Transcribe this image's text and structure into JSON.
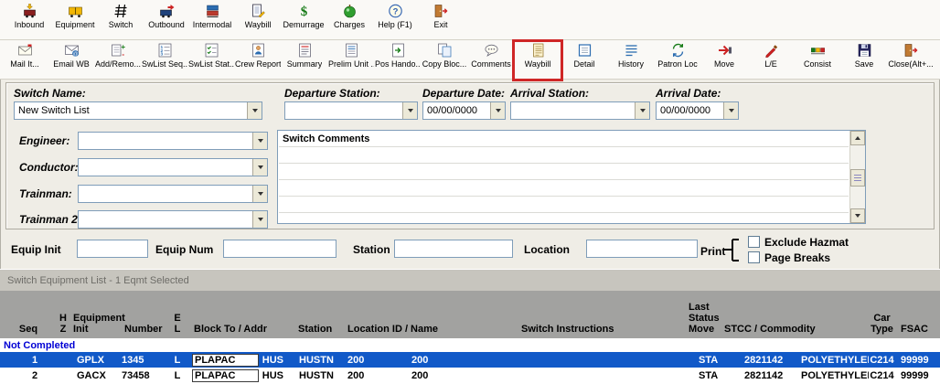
{
  "colors": {
    "highlight_box_red": "#CF2626",
    "selected_row_blue": "#1159C8",
    "group_label_blue": "#0000D4",
    "grid_header_gray": "#A2A2A0"
  },
  "toolbar_main": {
    "items": [
      {
        "label": "Inbound",
        "icon": "inbound-icon"
      },
      {
        "label": "Equipment",
        "icon": "equipment-icon"
      },
      {
        "label": "Switch",
        "icon": "switch-icon"
      },
      {
        "label": "Outbound",
        "icon": "outbound-icon"
      },
      {
        "label": "Intermodal",
        "icon": "intermodal-icon"
      },
      {
        "label": "Waybill",
        "icon": "waybill-pencil-icon"
      },
      {
        "label": "Demurrage",
        "icon": "dollar-icon"
      },
      {
        "label": "Charges",
        "icon": "charges-icon"
      },
      {
        "label": "Help (F1)",
        "icon": "help-icon"
      },
      {
        "label": "Exit",
        "icon": "exit-door-icon"
      }
    ]
  },
  "toolbar_secondary": {
    "items": [
      {
        "label": "Mail It...",
        "icon": "mail-icon"
      },
      {
        "label": "Email WB",
        "icon": "email-icon"
      },
      {
        "label": "Add/Remo...",
        "icon": "add-remove-icon"
      },
      {
        "label": "SwList Seq...",
        "icon": "swlist-seq-icon"
      },
      {
        "label": "SwList Stat...",
        "icon": "swlist-stat-icon"
      },
      {
        "label": "Crew Report",
        "icon": "crew-report-icon"
      },
      {
        "label": "Summary",
        "icon": "summary-icon"
      },
      {
        "label": "Prelim Unit ...",
        "icon": "prelim-unit-icon"
      },
      {
        "label": "Pos Hando...",
        "icon": "pos-handoff-icon"
      },
      {
        "label": "Copy Bloc...",
        "icon": "copy-block-icon"
      },
      {
        "label": "Comments",
        "icon": "comments-icon"
      },
      {
        "label": "Waybill",
        "icon": "waybill-doc-icon",
        "highlighted": true
      },
      {
        "label": "Detail",
        "icon": "detail-icon"
      },
      {
        "label": "History",
        "icon": "history-icon"
      },
      {
        "label": "Patron Loc",
        "icon": "patron-loc-icon"
      },
      {
        "label": "Move",
        "icon": "move-icon"
      },
      {
        "label": "L/E",
        "icon": "le-pencil-icon"
      },
      {
        "label": "Consist",
        "icon": "consist-icon"
      },
      {
        "label": "Save",
        "icon": "save-icon"
      },
      {
        "label": "Close(Alt+...",
        "icon": "close-door-icon"
      }
    ]
  },
  "form": {
    "switch_name": {
      "label": "Switch Name:",
      "value": "New Switch List"
    },
    "departure_station": {
      "label": "Departure Station:",
      "value": ""
    },
    "departure_date": {
      "label": "Departure Date:",
      "value": "00/00/0000"
    },
    "arrival_station": {
      "label": "Arrival Station:",
      "value": ""
    },
    "arrival_date": {
      "label": "Arrival Date:",
      "value": "00/00/0000"
    },
    "engineer": {
      "label": "Engineer:",
      "value": ""
    },
    "conductor": {
      "label": "Conductor:",
      "value": ""
    },
    "trainman": {
      "label": "Trainman:",
      "value": ""
    },
    "trainman2": {
      "label": "Trainman 2:",
      "value": ""
    },
    "switch_comments": {
      "label": "Switch Comments"
    }
  },
  "filter": {
    "equip_init": {
      "label": "Equip Init",
      "value": ""
    },
    "equip_num": {
      "label": "Equip Num",
      "value": ""
    },
    "station": {
      "label": "Station",
      "value": ""
    },
    "location": {
      "label": "Location",
      "value": ""
    },
    "print_label": "Print",
    "exclude_hazmat": {
      "label": "Exclude Hazmat",
      "checked": false
    },
    "page_breaks": {
      "label": "Page Breaks",
      "checked": false
    }
  },
  "grid": {
    "title": "Switch Equipment List - 1 Eqmt Selected",
    "headers": {
      "seq": "Seq",
      "hz": "H\nZ",
      "equipment": "Equipment",
      "init": "Init",
      "number": "Number",
      "el": "E\nL",
      "block_to": "Block To /  Addr",
      "station": "Station",
      "location": "Location ID / Name",
      "switch_instructions": "Switch Instructions",
      "last_status_move": "Last\nStatus\nMove",
      "stcc_commodity": "STCC / Commodity",
      "car_type": "Car\nType",
      "fsac": "FSAC"
    },
    "group_label": "Not Completed",
    "rows": [
      {
        "seq": "1",
        "hz": "",
        "equipment_init": "GPLX",
        "number": "1345",
        "el": "L",
        "block_to": "PLAPAC",
        "addr": "HUS",
        "station": "HUSTN",
        "location_id": "200",
        "location_name": "200",
        "switch_instructions": "",
        "last_status_move": "STA",
        "stcc": "2821142",
        "commodity": "POLYETHYLENE",
        "car_type": "C214",
        "fsac": "99999",
        "selected": true
      },
      {
        "seq": "2",
        "hz": "",
        "equipment_init": "GACX",
        "number": "73458",
        "el": "L",
        "block_to": "PLAPAC",
        "addr": "HUS",
        "station": "HUSTN",
        "location_id": "200",
        "location_name": "200",
        "switch_instructions": "",
        "last_status_move": "STA",
        "stcc": "2821142",
        "commodity": "POLYETHYLENE",
        "car_type": "C214",
        "fsac": "99999",
        "selected": false
      }
    ]
  }
}
